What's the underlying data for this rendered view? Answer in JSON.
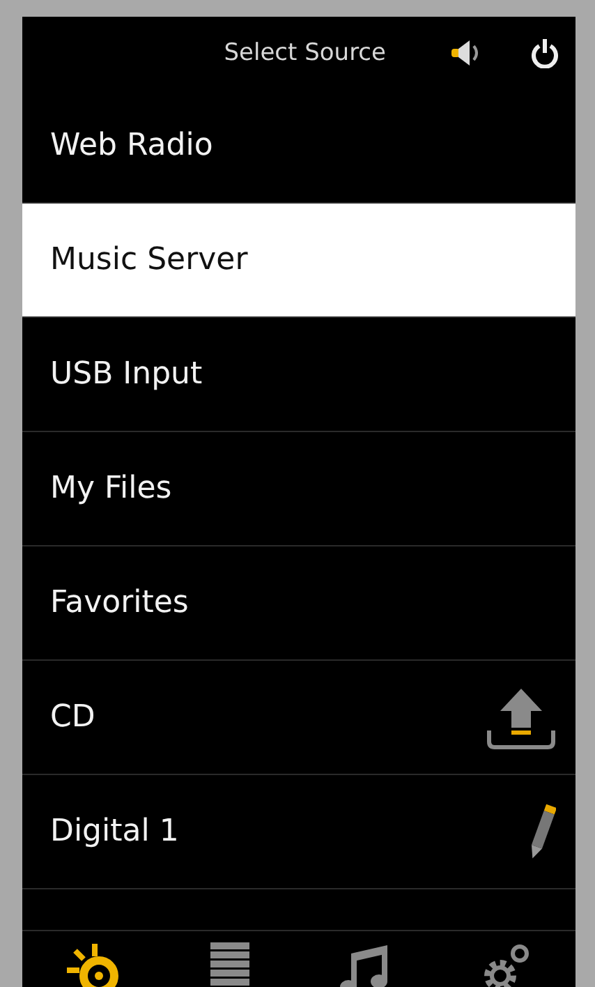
{
  "header": {
    "title": "Select Source"
  },
  "sources": [
    {
      "label": "Web Radio",
      "selected": false,
      "kind": "plain"
    },
    {
      "label": "Music Server",
      "selected": true,
      "kind": "plain"
    },
    {
      "label": "USB Input",
      "selected": false,
      "kind": "plain"
    },
    {
      "label": "My Files",
      "selected": false,
      "kind": "plain"
    },
    {
      "label": "Favorites",
      "selected": false,
      "kind": "plain"
    },
    {
      "label": "CD",
      "selected": false,
      "kind": "eject"
    },
    {
      "label": "Digital 1",
      "selected": false,
      "kind": "edit"
    }
  ],
  "nav": [
    {
      "kind": "source",
      "selected": true
    },
    {
      "kind": "list",
      "selected": false
    },
    {
      "kind": "music",
      "selected": false
    },
    {
      "kind": "settings",
      "selected": false
    }
  ]
}
